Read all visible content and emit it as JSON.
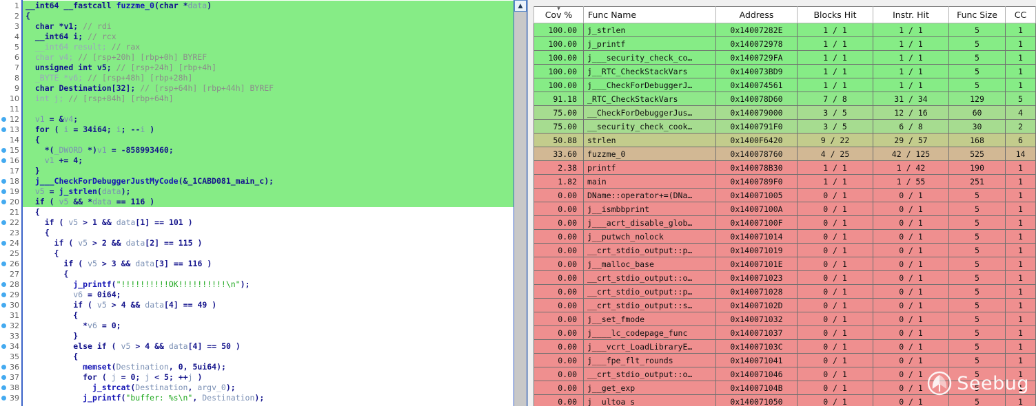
{
  "code_pane": {
    "scrollbar": {
      "up_arrow_icon": "chevron-up-icon"
    },
    "lines": [
      {
        "n": "1",
        "dot": false,
        "hl": true,
        "html": "<span class=\"typ\">__int64</span> <span class=\"typ\">__fastcall</span> <span class=\"fn\">fuzzme_0</span><span class=\"pn\">(</span><span class=\"typ\">char</span> <span class=\"pn\">*</span><span class=\"var\">data</span><span class=\"pn\">)</span>"
      },
      {
        "n": "2",
        "dot": false,
        "hl": true,
        "html": "<span class=\"pn\">{</span>"
      },
      {
        "n": "3",
        "dot": false,
        "hl": true,
        "html": "  <span class=\"typ\">char</span> <span class=\"pn\">*</span><span class=\"kw\">v1</span><span class=\"pn\">;</span> <span class=\"cmt\">// rdi</span>"
      },
      {
        "n": "4",
        "dot": false,
        "hl": true,
        "html": "  <span class=\"typ\">__int64</span> <span class=\"kw\">i</span><span class=\"pn\">;</span> <span class=\"cmt\">// rcx</span>"
      },
      {
        "n": "5",
        "dot": false,
        "hl": true,
        "html": "  <span class=\"dim\">__int64 result;</span> <span class=\"cmt\">// rax</span>"
      },
      {
        "n": "6",
        "dot": false,
        "hl": true,
        "html": "  <span class=\"dim\">char v4;</span> <span class=\"cmt\">// [rsp+20h] [rbp+0h] BYREF</span>"
      },
      {
        "n": "7",
        "dot": false,
        "hl": true,
        "html": "  <span class=\"typ\">unsigned int</span> <span class=\"kw\">v5</span><span class=\"pn\">;</span> <span class=\"cmt\">// [rsp+24h] [rbp+4h]</span>"
      },
      {
        "n": "8",
        "dot": false,
        "hl": true,
        "html": "  <span class=\"dim\">_BYTE *v6;</span> <span class=\"cmt\">// [rsp+48h] [rbp+28h]</span>"
      },
      {
        "n": "9",
        "dot": false,
        "hl": true,
        "html": "  <span class=\"typ\">char</span> <span class=\"kw\">Destination[32]</span><span class=\"pn\">;</span> <span class=\"cmt\">// [rsp+64h] [rbp+44h] BYREF</span>"
      },
      {
        "n": "10",
        "dot": false,
        "hl": true,
        "html": "  <span class=\"dim\">int j;</span> <span class=\"cmt\">// [rsp+84h] [rbp+64h]</span>"
      },
      {
        "n": "11",
        "dot": false,
        "hl": true,
        "html": ""
      },
      {
        "n": "12",
        "dot": true,
        "hl": true,
        "html": "  <span class=\"var\">v1</span> <span class=\"pn\">= &amp;</span><span class=\"var\">v4</span><span class=\"pn\">;</span>"
      },
      {
        "n": "13",
        "dot": true,
        "hl": true,
        "html": "  <span class=\"kw\">for</span> <span class=\"pn\">(</span> <span class=\"var\">i</span> <span class=\"pn\">=</span> <span class=\"num\">34i64</span><span class=\"pn\">;</span> <span class=\"var\">i</span><span class=\"pn\">;</span> <span class=\"pn\">--</span><span class=\"var\">i</span> <span class=\"pn\">)</span>"
      },
      {
        "n": "14",
        "dot": false,
        "hl": true,
        "html": "  <span class=\"pn\">{</span>"
      },
      {
        "n": "15",
        "dot": true,
        "hl": true,
        "html": "    <span class=\"pn\">*(</span><span class=\"var\">_DWORD </span><span class=\"pn\">*)</span><span class=\"var\">v1</span> <span class=\"pn\">=</span> <span class=\"num\">-858993460</span><span class=\"pn\">;</span>"
      },
      {
        "n": "16",
        "dot": true,
        "hl": true,
        "html": "    <span class=\"var\">v1</span> <span class=\"pn\">+=</span> <span class=\"num\">4</span><span class=\"pn\">;</span>"
      },
      {
        "n": "17",
        "dot": false,
        "hl": true,
        "html": "  <span class=\"pn\">}</span>"
      },
      {
        "n": "18",
        "dot": true,
        "hl": true,
        "html": "  <span class=\"fn\">j___CheckForDebuggerJustMyCode</span><span class=\"pn\">(&amp;</span><span class=\"kw\">_1CABD081_main_c</span><span class=\"pn\">);</span>"
      },
      {
        "n": "19",
        "dot": true,
        "hl": true,
        "html": "  <span class=\"var\">v5</span> <span class=\"pn\">=</span> <span class=\"fn\">j_strlen</span><span class=\"pn\">(</span><span class=\"var\">data</span><span class=\"pn\">);</span>"
      },
      {
        "n": "20",
        "dot": true,
        "hl": true,
        "html": "  <span class=\"kw\">if</span> <span class=\"pn\">(</span> <span class=\"var\">v5</span> <span class=\"pn\">&amp;&amp;</span> <span class=\"pn\">*</span><span class=\"var\">data</span> <span class=\"pn\">==</span> <span class=\"num\">116</span> <span class=\"pn\">)</span>"
      },
      {
        "n": "21",
        "dot": false,
        "hl": false,
        "html": "  <span class=\"pn\">{</span>"
      },
      {
        "n": "22",
        "dot": true,
        "hl": false,
        "html": "    <span class=\"kw\">if</span> <span class=\"pn\">(</span> <span class=\"var\">v5</span> <span class=\"pn\">&gt;</span> <span class=\"num\">1</span> <span class=\"pn\">&amp;&amp;</span> <span class=\"var\">data</span><span class=\"pn\">[</span><span class=\"num\">1</span><span class=\"pn\">] ==</span> <span class=\"num\">101</span> <span class=\"pn\">)</span>"
      },
      {
        "n": "23",
        "dot": false,
        "hl": false,
        "html": "    <span class=\"pn\">{</span>"
      },
      {
        "n": "24",
        "dot": true,
        "hl": false,
        "html": "      <span class=\"kw\">if</span> <span class=\"pn\">(</span> <span class=\"var\">v5</span> <span class=\"pn\">&gt;</span> <span class=\"num\">2</span> <span class=\"pn\">&amp;&amp;</span> <span class=\"var\">data</span><span class=\"pn\">[</span><span class=\"num\">2</span><span class=\"pn\">] ==</span> <span class=\"num\">115</span> <span class=\"pn\">)</span>"
      },
      {
        "n": "25",
        "dot": false,
        "hl": false,
        "html": "      <span class=\"pn\">{</span>"
      },
      {
        "n": "26",
        "dot": true,
        "hl": false,
        "html": "        <span class=\"kw\">if</span> <span class=\"pn\">(</span> <span class=\"var\">v5</span> <span class=\"pn\">&gt;</span> <span class=\"num\">3</span> <span class=\"pn\">&amp;&amp;</span> <span class=\"var\">data</span><span class=\"pn\">[</span><span class=\"num\">3</span><span class=\"pn\">] ==</span> <span class=\"num\">116</span> <span class=\"pn\">)</span>"
      },
      {
        "n": "27",
        "dot": false,
        "hl": false,
        "html": "        <span class=\"pn\">{</span>"
      },
      {
        "n": "28",
        "dot": true,
        "hl": false,
        "html": "          <span class=\"fn\">j_printf</span><span class=\"pn\">(</span><span class=\"str\">\"!!!!!!!!!!OK!!!!!!!!!!\\n\"</span><span class=\"pn\">);</span>"
      },
      {
        "n": "29",
        "dot": true,
        "hl": false,
        "html": "          <span class=\"var\">v6</span> <span class=\"pn\">=</span> <span class=\"num\">0i64</span><span class=\"pn\">;</span>"
      },
      {
        "n": "30",
        "dot": true,
        "hl": false,
        "html": "          <span class=\"kw\">if</span> <span class=\"pn\">(</span> <span class=\"var\">v5</span> <span class=\"pn\">&gt;</span> <span class=\"num\">4</span> <span class=\"pn\">&amp;&amp;</span> <span class=\"var\">data</span><span class=\"pn\">[</span><span class=\"num\">4</span><span class=\"pn\">] ==</span> <span class=\"num\">49</span> <span class=\"pn\">)</span>"
      },
      {
        "n": "31",
        "dot": false,
        "hl": false,
        "html": "          <span class=\"pn\">{</span>"
      },
      {
        "n": "32",
        "dot": true,
        "hl": false,
        "html": "            <span class=\"pn\">*</span><span class=\"var\">v6</span> <span class=\"pn\">=</span> <span class=\"num\">0</span><span class=\"pn\">;</span>"
      },
      {
        "n": "33",
        "dot": false,
        "hl": false,
        "html": "          <span class=\"pn\">}</span>"
      },
      {
        "n": "34",
        "dot": true,
        "hl": false,
        "html": "          <span class=\"kw\">else if</span> <span class=\"pn\">(</span> <span class=\"var\">v5</span> <span class=\"pn\">&gt;</span> <span class=\"num\">4</span> <span class=\"pn\">&amp;&amp;</span> <span class=\"var\">data</span><span class=\"pn\">[</span><span class=\"num\">4</span><span class=\"pn\">] ==</span> <span class=\"num\">50</span> <span class=\"pn\">)</span>"
      },
      {
        "n": "35",
        "dot": false,
        "hl": false,
        "html": "          <span class=\"pn\">{</span>"
      },
      {
        "n": "36",
        "dot": true,
        "hl": false,
        "html": "            <span class=\"fn\">memset</span><span class=\"pn\">(</span><span class=\"var\">Destination</span><span class=\"pn\">,</span> <span class=\"num\">0</span><span class=\"pn\">,</span> <span class=\"num\">5ui64</span><span class=\"pn\">);</span>"
      },
      {
        "n": "37",
        "dot": true,
        "hl": false,
        "html": "            <span class=\"kw\">for</span> <span class=\"pn\">(</span> <span class=\"var\">j</span> <span class=\"pn\">=</span> <span class=\"num\">0</span><span class=\"pn\">;</span> <span class=\"var\">j</span> <span class=\"pn\">&lt;</span> <span class=\"num\">5</span><span class=\"pn\">;</span> <span class=\"pn\">++</span><span class=\"var\">j</span> <span class=\"pn\">)</span>"
      },
      {
        "n": "38",
        "dot": true,
        "hl": false,
        "html": "              <span class=\"fn\">j_strcat</span><span class=\"pn\">(</span><span class=\"var\">Destination</span><span class=\"pn\">,</span> <span class=\"var\">argv_0</span><span class=\"pn\">);</span>"
      },
      {
        "n": "39",
        "dot": true,
        "hl": false,
        "html": "            <span class=\"fn\">j_printf</span><span class=\"pn\">(</span><span class=\"str\">\"buffer: %s\\n\"</span><span class=\"pn\">,</span> <span class=\"var\">Destination</span><span class=\"pn\">);</span>"
      }
    ]
  },
  "coverage_table": {
    "columns": [
      "Cov %",
      "Func Name",
      "Address",
      "Blocks Hit",
      "Instr. Hit",
      "Func Size",
      "CC"
    ],
    "sorted_column": "Cov %",
    "sort_icon": "chevron-down-icon",
    "rows": [
      {
        "cov": "100.00",
        "name": "j_strlen",
        "addr": "0x14007282E",
        "blocks": "1 / 1",
        "instr": "1 / 1",
        "size": "5",
        "cc": "1",
        "color": "#86ec86"
      },
      {
        "cov": "100.00",
        "name": "j_printf",
        "addr": "0x140072978",
        "blocks": "1 / 1",
        "instr": "1 / 1",
        "size": "5",
        "cc": "1",
        "color": "#86ec86"
      },
      {
        "cov": "100.00",
        "name": "j___security_check_co…",
        "addr": "0x1400729FA",
        "blocks": "1 / 1",
        "instr": "1 / 1",
        "size": "5",
        "cc": "1",
        "color": "#86ec86"
      },
      {
        "cov": "100.00",
        "name": "j__RTC_CheckStackVars",
        "addr": "0x140073BD9",
        "blocks": "1 / 1",
        "instr": "1 / 1",
        "size": "5",
        "cc": "1",
        "color": "#86ec86"
      },
      {
        "cov": "100.00",
        "name": "j___CheckForDebuggerJ…",
        "addr": "0x140074561",
        "blocks": "1 / 1",
        "instr": "1 / 1",
        "size": "5",
        "cc": "1",
        "color": "#86ec86"
      },
      {
        "cov": "91.18",
        "name": "_RTC_CheckStackVars",
        "addr": "0x140078D60",
        "blocks": "7 / 8",
        "instr": "31 / 34",
        "size": "129",
        "cc": "5",
        "color": "#8fe88a"
      },
      {
        "cov": "75.00",
        "name": "__CheckForDebuggerJus…",
        "addr": "0x140079000",
        "blocks": "3 / 5",
        "instr": "12 / 16",
        "size": "60",
        "cc": "4",
        "color": "#a6dc90"
      },
      {
        "cov": "75.00",
        "name": "__security_check_cook…",
        "addr": "0x1400791F0",
        "blocks": "3 / 5",
        "instr": "6 / 8",
        "size": "30",
        "cc": "2",
        "color": "#a6dc90"
      },
      {
        "cov": "50.88",
        "name": "strlen",
        "addr": "0x1400F6420",
        "blocks": "9 / 22",
        "instr": "29 / 57",
        "size": "168",
        "cc": "6",
        "color": "#c3cc8c"
      },
      {
        "cov": "33.60",
        "name": "fuzzme_0",
        "addr": "0x140078760",
        "blocks": "4 / 25",
        "instr": "42 / 125",
        "size": "525",
        "cc": "14",
        "color": "#d2b894"
      },
      {
        "cov": "2.38",
        "name": "printf",
        "addr": "0x140078B30",
        "blocks": "1 / 1",
        "instr": "1 / 42",
        "size": "190",
        "cc": "1",
        "color": "#ef8f8f"
      },
      {
        "cov": "1.82",
        "name": "main",
        "addr": "0x1400789F0",
        "blocks": "1 / 1",
        "instr": "1 / 55",
        "size": "251",
        "cc": "1",
        "color": "#ef8f8f"
      },
      {
        "cov": "0.00",
        "name": "DName::operator+=(DNa…",
        "addr": "0x140071005",
        "blocks": "0 / 1",
        "instr": "0 / 1",
        "size": "5",
        "cc": "1",
        "color": "#ef8f8f"
      },
      {
        "cov": "0.00",
        "name": "j__ismbbprint",
        "addr": "0x14007100A",
        "blocks": "0 / 1",
        "instr": "0 / 1",
        "size": "5",
        "cc": "1",
        "color": "#ef8f8f"
      },
      {
        "cov": "0.00",
        "name": "j___acrt_disable_glob…",
        "addr": "0x14007100F",
        "blocks": "0 / 1",
        "instr": "0 / 1",
        "size": "5",
        "cc": "1",
        "color": "#ef8f8f"
      },
      {
        "cov": "0.00",
        "name": "j__putwch_nolock",
        "addr": "0x140071014",
        "blocks": "0 / 1",
        "instr": "0 / 1",
        "size": "5",
        "cc": "1",
        "color": "#ef8f8f"
      },
      {
        "cov": "0.00",
        "name": "__crt_stdio_output::p…",
        "addr": "0x140071019",
        "blocks": "0 / 1",
        "instr": "0 / 1",
        "size": "5",
        "cc": "1",
        "color": "#ef8f8f"
      },
      {
        "cov": "0.00",
        "name": "j__malloc_base",
        "addr": "0x14007101E",
        "blocks": "0 / 1",
        "instr": "0 / 1",
        "size": "5",
        "cc": "1",
        "color": "#ef8f8f"
      },
      {
        "cov": "0.00",
        "name": "__crt_stdio_output::o…",
        "addr": "0x140071023",
        "blocks": "0 / 1",
        "instr": "0 / 1",
        "size": "5",
        "cc": "1",
        "color": "#ef8f8f"
      },
      {
        "cov": "0.00",
        "name": "__crt_stdio_output::p…",
        "addr": "0x140071028",
        "blocks": "0 / 1",
        "instr": "0 / 1",
        "size": "5",
        "cc": "1",
        "color": "#ef8f8f"
      },
      {
        "cov": "0.00",
        "name": "__crt_stdio_output::s…",
        "addr": "0x14007102D",
        "blocks": "0 / 1",
        "instr": "0 / 1",
        "size": "5",
        "cc": "1",
        "color": "#ef8f8f"
      },
      {
        "cov": "0.00",
        "name": "j__set_fmode",
        "addr": "0x140071032",
        "blocks": "0 / 1",
        "instr": "0 / 1",
        "size": "5",
        "cc": "1",
        "color": "#ef8f8f"
      },
      {
        "cov": "0.00",
        "name": "j____lc_codepage_func",
        "addr": "0x140071037",
        "blocks": "0 / 1",
        "instr": "0 / 1",
        "size": "5",
        "cc": "1",
        "color": "#ef8f8f"
      },
      {
        "cov": "0.00",
        "name": "j___vcrt_LoadLibraryE…",
        "addr": "0x14007103C",
        "blocks": "0 / 1",
        "instr": "0 / 1",
        "size": "5",
        "cc": "1",
        "color": "#ef8f8f"
      },
      {
        "cov": "0.00",
        "name": "j___fpe_flt_rounds",
        "addr": "0x140071041",
        "blocks": "0 / 1",
        "instr": "0 / 1",
        "size": "5",
        "cc": "1",
        "color": "#ef8f8f"
      },
      {
        "cov": "0.00",
        "name": "__crt_stdio_output::o…",
        "addr": "0x140071046",
        "blocks": "0 / 1",
        "instr": "0 / 1",
        "size": "5",
        "cc": "1",
        "color": "#ef8f8f"
      },
      {
        "cov": "0.00",
        "name": "j__get_exp",
        "addr": "0x14007104B",
        "blocks": "0 / 1",
        "instr": "0 / 1",
        "size": "5",
        "cc": "1",
        "color": "#ef8f8f"
      },
      {
        "cov": "0.00",
        "name": "j__ultoa_s",
        "addr": "0x140071050",
        "blocks": "0 / 1",
        "instr": "0 / 1",
        "size": "5",
        "cc": "1",
        "color": "#ef8f8f"
      }
    ]
  },
  "watermark": {
    "text": "Seebug",
    "logo_icon": "seebug-logo-icon"
  }
}
